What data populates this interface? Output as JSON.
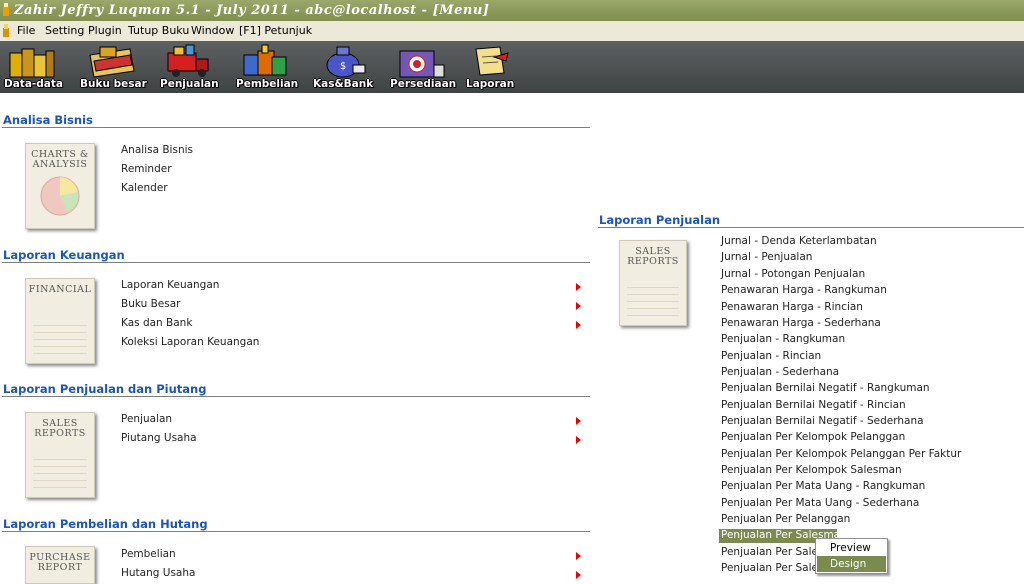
{
  "window": {
    "title": "Zahir Jeffry Luqman 5.1 - July 2011 - abc@localhost - [Menu]"
  },
  "menubar": {
    "items": [
      "File",
      "Setting",
      "Plugin",
      "Tutup Buku",
      "Window",
      "[F1] Petunjuk"
    ]
  },
  "toolbar": {
    "buttons": [
      "Data-data",
      "Buku besar",
      "Penjualan",
      "Pembelian",
      "Kas&Bank",
      "Persediaan",
      "Laporan"
    ]
  },
  "sections": {
    "analisa": {
      "title": "Analisa Bisnis",
      "book": "CHARTS & ANALYSIS",
      "items": [
        "Analisa Bisnis",
        "Reminder",
        "Kalender"
      ]
    },
    "keuangan": {
      "title": "Laporan Keuangan",
      "book": "FINANCIAL",
      "items": [
        "Laporan Keuangan",
        "Buku Besar",
        "Kas dan Bank",
        "Koleksi Laporan Keuangan"
      ]
    },
    "penjualan_piutang": {
      "title": "Laporan Penjualan dan Piutang",
      "book": "SALES REPORTS",
      "items": [
        "Penjualan",
        "Piutang Usaha"
      ]
    },
    "pembelian_hutang": {
      "title": "Laporan Pembelian dan Hutang",
      "book": "PURCHASE REPORT",
      "items": [
        "Pembelian",
        "Hutang Usaha"
      ]
    },
    "laporan_penjualan": {
      "title": "Laporan Penjualan",
      "book": "SALES REPORTS",
      "items": [
        "Jurnal - Denda Keterlambatan",
        "Jurnal - Penjualan",
        "Jurnal - Potongan Penjualan",
        "Penawaran Harga - Rangkuman",
        "Penawaran Harga - Rincian",
        "Penawaran Harga - Sederhana",
        "Penjualan - Rangkuman",
        "Penjualan - Rincian",
        "Penjualan - Sederhana",
        "Penjualan Bernilai Negatif - Rangkuman",
        "Penjualan Bernilai Negatif - Rincian",
        "Penjualan Bernilai Negatif - Sederhana",
        "Penjualan Per Kelompok Pelanggan",
        "Penjualan Per Kelompok Pelanggan Per Faktur",
        "Penjualan Per Kelompok Salesman",
        "Penjualan Per Mata Uang - Rangkuman",
        "Penjualan Per Mata Uang - Sederhana",
        "Penjualan Per Pelanggan",
        "Penjualan Per Salesman",
        "Penjualan Per Sales",
        "Penjualan Per Sales"
      ]
    }
  },
  "context_menu": {
    "items": [
      "Preview",
      "Design"
    ]
  },
  "colors": {
    "section_title": "#1c56b6",
    "highlight": "#7b8b50",
    "arrow": "#e00000"
  }
}
